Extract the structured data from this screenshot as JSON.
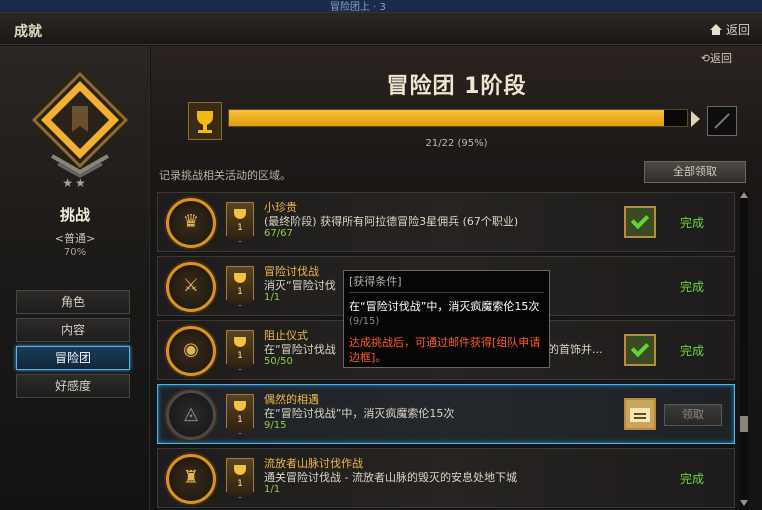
{
  "topstrip": "冒险团上 · 3",
  "window": {
    "title": "成就",
    "home_label": "返回"
  },
  "left": {
    "stars": "★★",
    "category": "挑战",
    "difficulty": "<普通>",
    "percent": "70%",
    "nav": [
      {
        "label": "角色"
      },
      {
        "label": "内容"
      },
      {
        "label": "冒险团"
      },
      {
        "label": "好感度"
      }
    ]
  },
  "main": {
    "back_label": "返回",
    "title": "冒险团 1阶段",
    "progress": {
      "text": "21/22 (95%)",
      "fraction": 0.95
    },
    "description": "记录挑战相关活动的区域。",
    "claim_all": "全部领取",
    "rows": [
      {
        "title": "小珍贵",
        "desc": "(最终阶段) 获得所有阿拉德冒险3星佣兵 (67个职业)",
        "count": "67/67",
        "rank": "1",
        "status": "完成",
        "icon": "soldier-icon",
        "reward": "check"
      },
      {
        "title": "冒险讨伐战",
        "desc": "消灭“冒险讨伐",
        "count": "1/1",
        "rank": "1",
        "status": "完成",
        "icon": "crossed-swords-icon",
        "reward": "none"
      },
      {
        "title": "阻止仪式",
        "desc": "在“冒险讨伐战",
        "desc2": "的首饰并...",
        "count": "50/50",
        "rank": "1",
        "status": "完成",
        "icon": "eye-icon",
        "reward": "check"
      },
      {
        "title": "偶然的相遇",
        "desc": "在“冒险讨伐战”中，消灭疯魔索伦15次",
        "count": "9/15",
        "rank": "1",
        "claim": "领取",
        "icon": "eye-icon",
        "reward": "scroll"
      },
      {
        "title": "流放者山脉讨伐作战",
        "desc": "通关冒险讨伐战 - 流放者山脉的毁灭的安息处地下城",
        "count": "1/1",
        "rank": "1",
        "status": "完成",
        "icon": "fortress-icon",
        "reward": "none"
      }
    ]
  },
  "tooltip": {
    "header": "[获得条件]",
    "task": "在“冒险讨伐战”中，消灭疯魔索伦15次",
    "progress": "(9/15)",
    "note": "达成挑战后，可通过邮件获得[组队申请边框]。"
  },
  "colors": {
    "accent": "#f3b81a",
    "complete": "#6ed640",
    "selected": "#4fb4e8"
  }
}
